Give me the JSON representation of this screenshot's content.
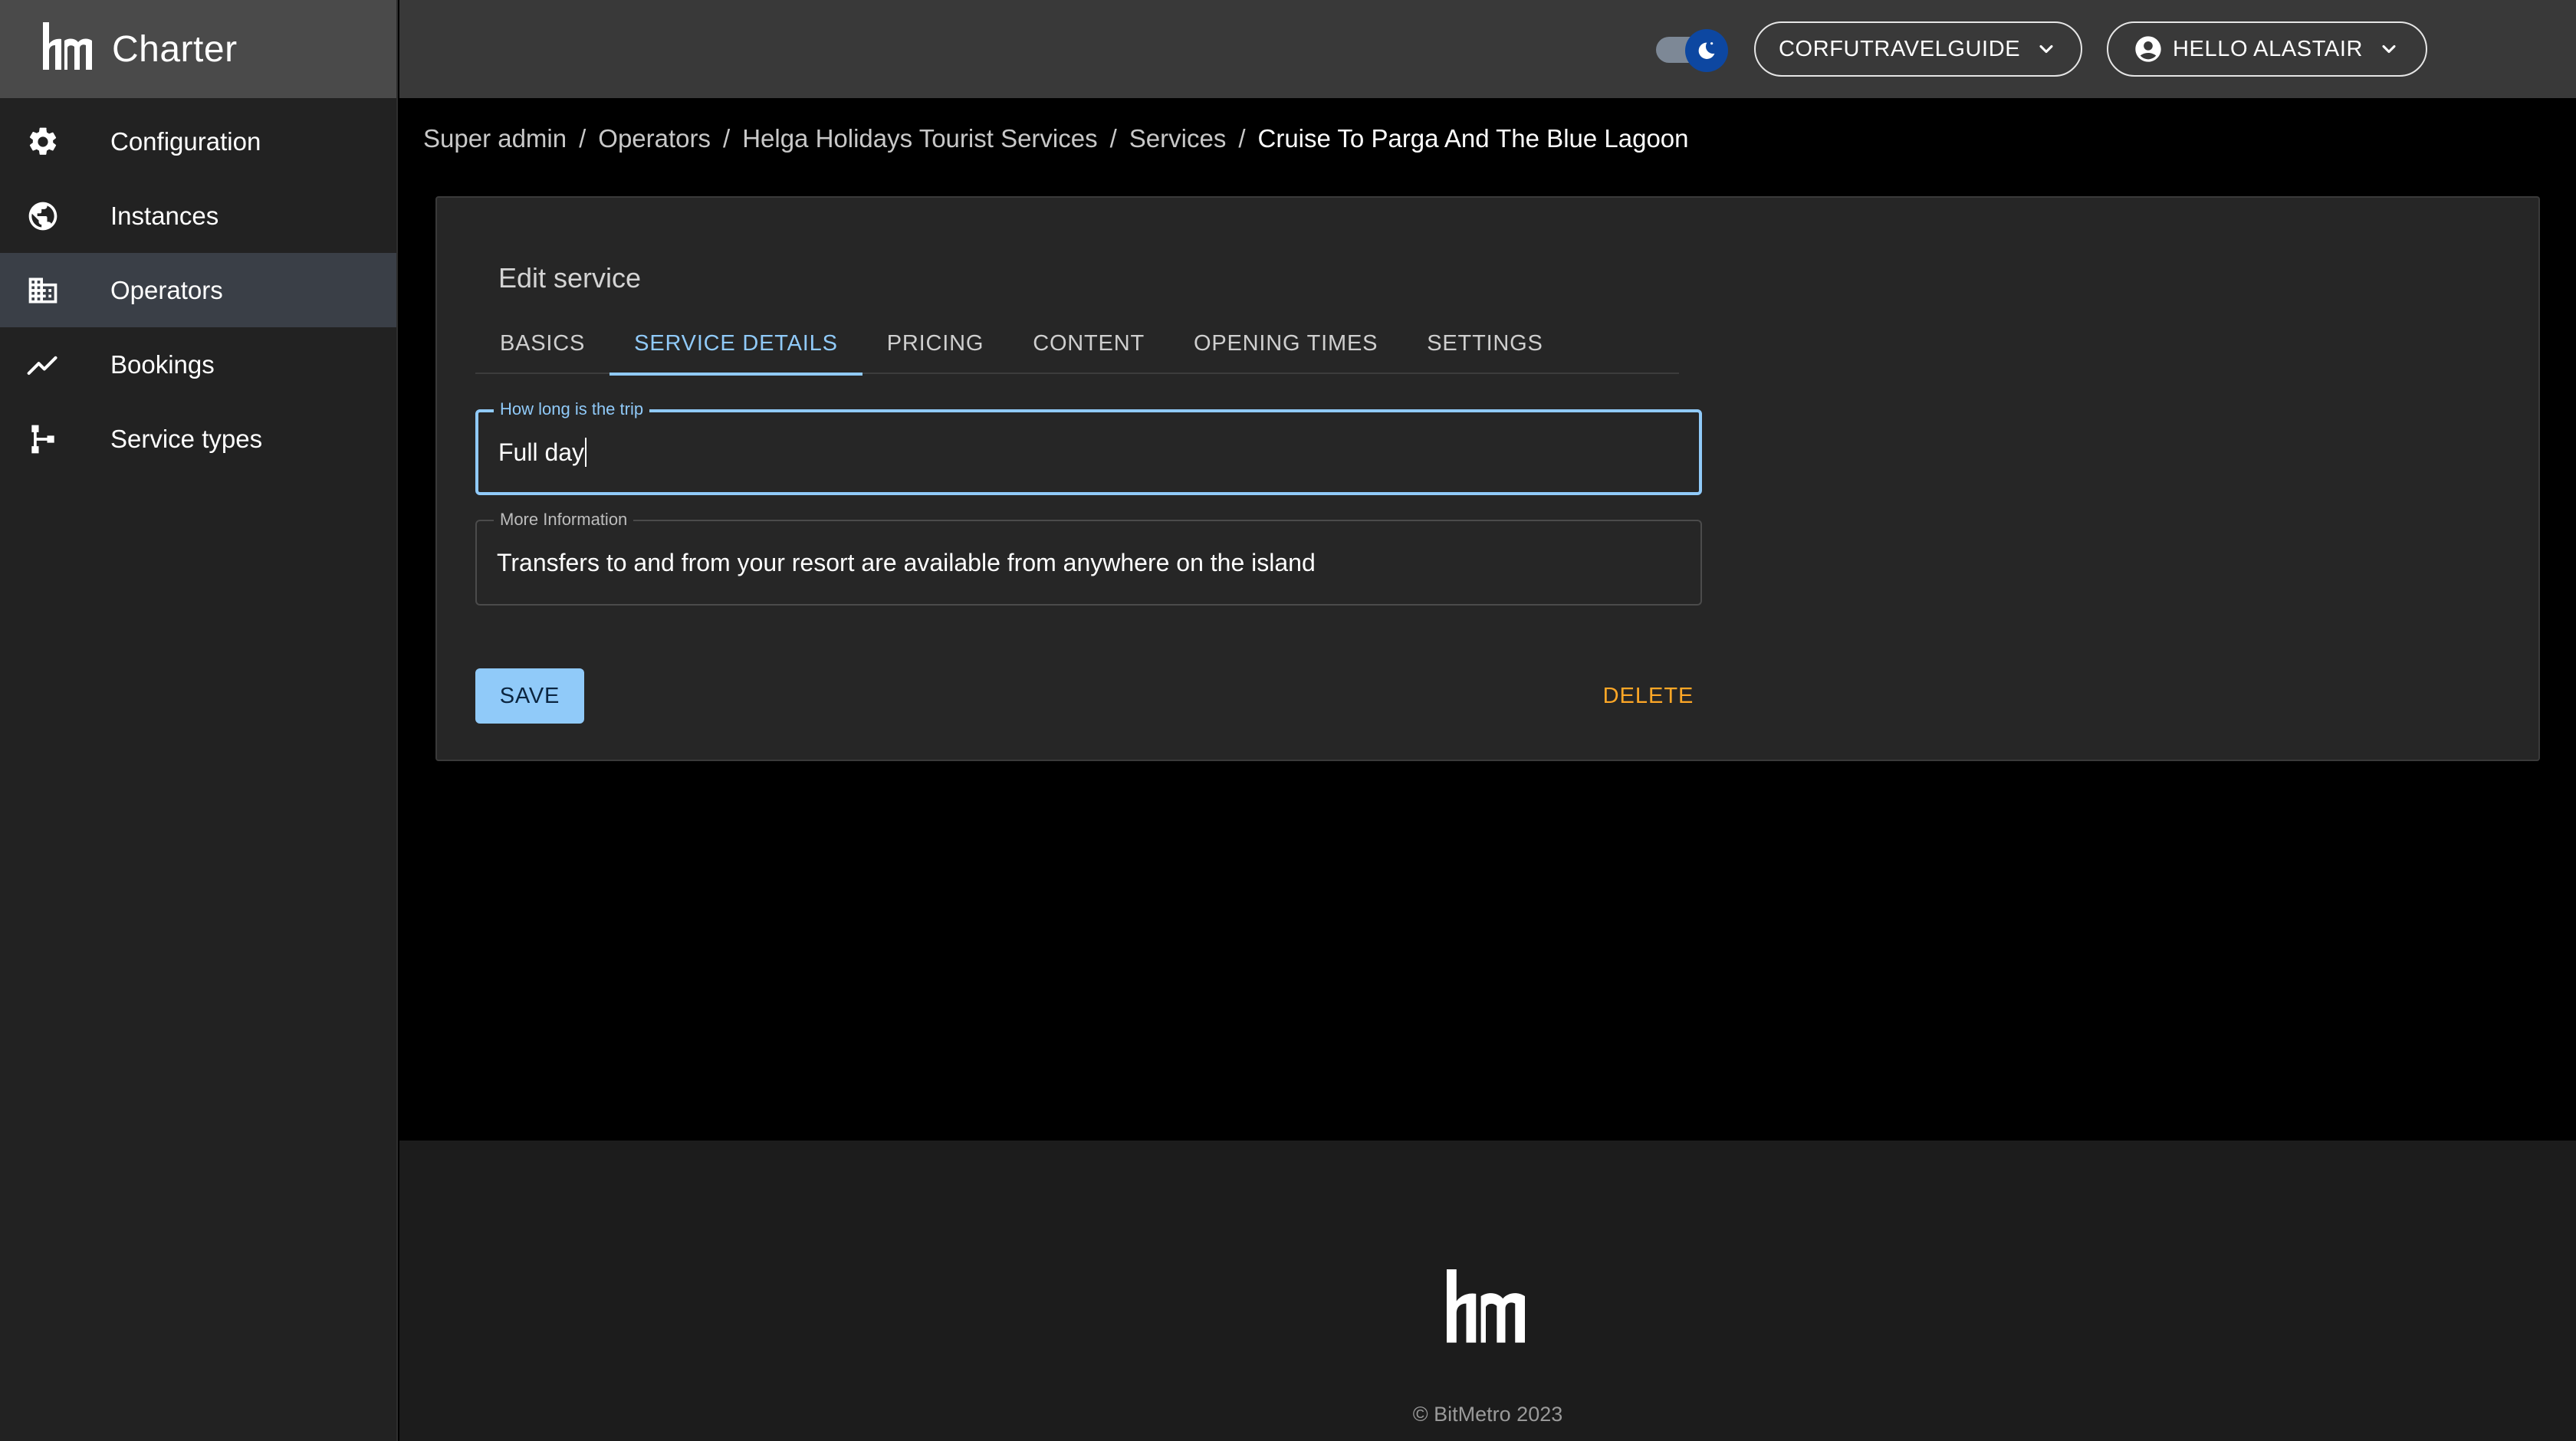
{
  "app": {
    "name": "Charter",
    "logo_icon": "bitmetro-logo-icon"
  },
  "sidebar": {
    "items": [
      {
        "label": "Configuration",
        "icon": "gear-icon",
        "active": false
      },
      {
        "label": "Instances",
        "icon": "globe-icon",
        "active": false
      },
      {
        "label": "Operators",
        "icon": "building-icon",
        "active": true
      },
      {
        "label": "Bookings",
        "icon": "trending-up-icon",
        "active": false
      },
      {
        "label": "Service types",
        "icon": "hierarchy-icon",
        "active": false
      }
    ]
  },
  "topbar": {
    "theme_toggle": {
      "mode": "dark",
      "icon": "moon-icon"
    },
    "account_label": "CORFUTRAVELGUIDE",
    "user_label": "HELLO ALASTAIR"
  },
  "breadcrumb": {
    "items": [
      "Super admin",
      "Operators",
      "Helga Holidays Tourist Services",
      "Services"
    ],
    "current": "Cruise To Parga And The Blue Lagoon"
  },
  "card": {
    "title": "Edit service",
    "tabs": [
      "BASICS",
      "SERVICE DETAILS",
      "PRICING",
      "CONTENT",
      "OPENING TIMES",
      "SETTINGS"
    ],
    "active_tab": 1,
    "fields": [
      {
        "label": "How long is the trip",
        "value": "Full day"
      },
      {
        "label": "More Information",
        "value": "Transfers to and from your resort are available from anywhere on the island"
      }
    ],
    "save_label": "SAVE",
    "delete_label": "DELETE"
  },
  "footer": {
    "copyright": "© BitMetro 2023"
  },
  "colors": {
    "accent": "#90caf9",
    "danger": "#ffa726",
    "sidebar_bg": "#222222",
    "topbar_bg": "#393939"
  }
}
